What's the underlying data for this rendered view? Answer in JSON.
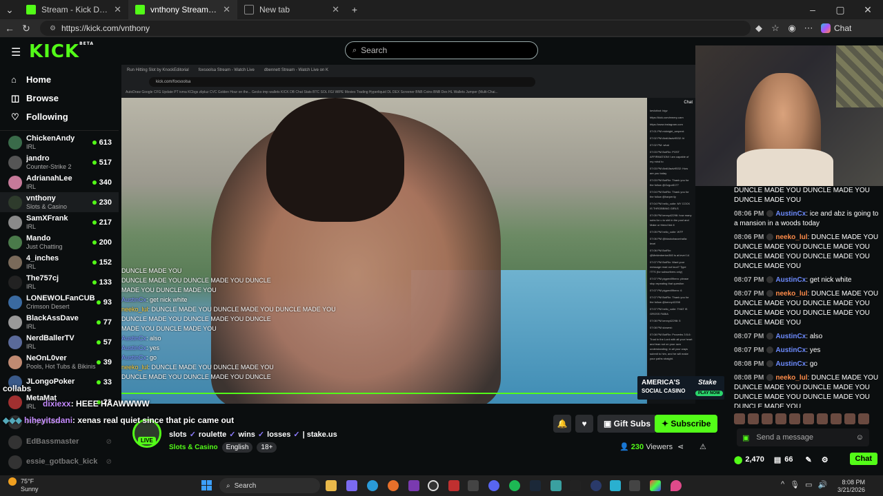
{
  "browser": {
    "tabs": [
      {
        "label": "Stream - Kick Dashboard",
        "active": false
      },
      {
        "label": "vnthony Stream - Watch Live on K",
        "active": true
      },
      {
        "label": "New tab",
        "active": false
      }
    ],
    "url": "https://kick.com/vnthony",
    "chat_label": "Chat"
  },
  "kick": {
    "logo": "KICK",
    "logo_tag": "BETA",
    "search_placeholder": "Search"
  },
  "sidebar": {
    "nav": [
      {
        "label": "Home",
        "icon": "home-icon"
      },
      {
        "label": "Browse",
        "icon": "browse-icon"
      },
      {
        "label": "Following",
        "icon": "heart-icon"
      }
    ],
    "channels": [
      {
        "name": "ChickenAndy",
        "category": "IRL",
        "viewers": "613",
        "color": "#3a6b4a"
      },
      {
        "name": "jandro",
        "category": "Counter-Strike 2",
        "viewers": "517",
        "color": "#555"
      },
      {
        "name": "AdrianahLee",
        "category": "IRL",
        "viewers": "340",
        "color": "#c67a9a"
      },
      {
        "name": "vnthony",
        "category": "Slots & Casino",
        "viewers": "230",
        "color": "#2e3b2c"
      },
      {
        "name": "SamXFrank",
        "category": "IRL",
        "viewers": "217",
        "color": "#8a8a8a"
      },
      {
        "name": "Mando",
        "category": "Just Chatting",
        "viewers": "200",
        "color": "#4a7a4a"
      },
      {
        "name": "4_inches",
        "category": "IRL",
        "viewers": "152",
        "color": "#7a6a5a"
      },
      {
        "name": "The757cj",
        "category": "IRL",
        "viewers": "133",
        "color": "#222"
      },
      {
        "name": "LONEWOLFanCUB",
        "category": "Crimson Desert",
        "viewers": "93",
        "color": "#3a6aa0"
      },
      {
        "name": "BlackAssDave",
        "category": "IRL",
        "viewers": "77",
        "color": "#999"
      },
      {
        "name": "NerdBallerTV",
        "category": "IRL",
        "viewers": "57",
        "color": "#5a6a9a"
      },
      {
        "name": "NeOnL0ver",
        "category": "Pools, Hot Tubs & Bikinis",
        "viewers": "39",
        "color": "#c08a72"
      },
      {
        "name": "JLongoPoker",
        "category": "",
        "viewers": "33",
        "color": "#3a5a8a"
      },
      {
        "name": "MetaMat",
        "category": "IRL",
        "viewers": "22",
        "color": "#a03030"
      }
    ],
    "offline": [
      {
        "name": "Heywhen"
      },
      {
        "name": "EdBassmaster"
      },
      {
        "name": "essie_gotback_kick"
      }
    ]
  },
  "inner_browser": {
    "tabs": [
      "Run Hitting Slot by KnockEditorial",
      "foxsoolsa Stream - Watch Live",
      "dbennett Stream - Watch Live on K"
    ],
    "url": "kick.com/foxsoolsa",
    "bookmarks": "AutoDraw  Google  CFG Update  PT  ivrna  KCbgs  zlipluz  CVC  Golden Hour on the...  Gecko  imp wallets  KICK  DB  Chat  Stats  BTC  SOL  FGI  WIPE  Movies  Trading  Hyperliquid  DL  DEX Screener  BNB Coins  BNB Dex  HL Wallets  Jumper (Multi-Chai...",
    "chat_title": "Chat",
    "chat_lines": [
      "kevlotbot: bigv",
      "https://kick.com/emery-cam",
      "https://www.instagram.com",
      "07:01 PM midnight_serpent:",
      "07:02 PM AbdUlaziz9532: hi",
      "07:02 PM: what",
      "07:03 PM BotRix: POST AFFIRMATION! I am capable of my mind to",
      "07:03 PM AbdUlaziz9532: How are you today",
      "07:03 PM BotRix: Thank you for the follow @Ozgur8177",
      "07:04 PM BotRix: Thank you for the follow @harper4y",
      "07:04 PM hello_cutie: MY COCK IS THROBBING GIRLS",
      "07:05 PM kenny42298: how many subs for u to shit in the pool and Make ur friend lick it",
      "07:05 PM hello_cutie: WTF",
      "07:06 PM @blackcbaconhalla: level",
      "07:06 PM BotRix: @Mekimberton360 is at level 14",
      "07:07 PM BotRix: Want your message read out loud? Type !TTS (for subscribers only)",
      "07:07 PM pigpevil9hero: please stop repeating that question",
      "07:07 PM pigpevil9hero: 6",
      "07:07 PM BotRix: Thank you for the follow @kenny42298",
      "07:07 PM hello_cutie: THAT IS GROSS FABIA",
      "07:08 PM kenny42298: 5",
      "07:08 PM slowest:",
      "07:08 PM BotRix: Proverbs 3:5-6: Trust in the Lord with all your heart and lean not on your own understanding; in all your ways submit to him, and he will make your paths straight."
    ]
  },
  "video_overlay": {
    "lines": [
      {
        "text": "DUNCLE MADE YOU",
        "user": "",
        "repeat": 3
      },
      {
        "text": "DUNCLE MADE YOU  DUNCLE MADE YOU  DUNCLE",
        "user": ""
      },
      {
        "text": "MADE YOU  DUNCLE MADE YOU",
        "user": ""
      },
      {
        "user": "AustinCx",
        "text": ": get nick white"
      },
      {
        "user": "neeko_lul",
        "text": ": DUNCLE MADE YOU  DUNCLE MADE YOU  DUNCLE MADE YOU"
      },
      {
        "text": "DUNCLE MADE YOU  DUNCLE MADE YOU  DUNCLE",
        "user": ""
      },
      {
        "text": "MADE YOU  DUNCLE MADE YOU",
        "user": ""
      },
      {
        "user": "AustinCx",
        "text": ": also"
      },
      {
        "user": "AustinCx",
        "text": ": yes"
      },
      {
        "user": "AustinCx",
        "text": ": go"
      },
      {
        "user": "neeko_lul",
        "text": ": DUNCLE MADE YOU  DUNCLE MADE YOU"
      },
      {
        "text": "DUNCLE MADE YOU  DUNCLE MADE YOU  DUNCLE",
        "user": ""
      }
    ],
    "ad": {
      "line1": "AMERICA'S",
      "line2": "SOCIAL CASINO",
      "brand": "Stake",
      "cta": "PLAY NOW"
    },
    "collabs": "collabs",
    "big_line1_user": "dixiexx",
    "big_line1_text": ": HEEE HAAWWWW",
    "big_line2_user": "hiheyitsdani",
    "big_line2_text": ": xenas real quiet since that pic came out"
  },
  "chat": {
    "messages": [
      {
        "time": "",
        "user": "",
        "user_color": "#fff",
        "text": "DUNCLE MADE YOU  DUNCLE MADE YOU  DUNCLE MADE YOU"
      },
      {
        "time": "08:06 PM",
        "user": "AustinCx",
        "user_color": "#6e8cff",
        "text": ": ice and abz is going to a mansion in a woods today"
      },
      {
        "time": "08:06 PM",
        "user": "neeko_lul",
        "user_color": "#ff8c4a",
        "text": ": DUNCLE MADE YOU  DUNCLE MADE YOU  DUNCLE MADE YOU  DUNCLE MADE YOU  DUNCLE MADE YOU  DUNCLE MADE YOU"
      },
      {
        "time": "08:07 PM",
        "user": "AustinCx",
        "user_color": "#6e8cff",
        "text": ": get nick white"
      },
      {
        "time": "08:07 PM",
        "user": "neeko_lul",
        "user_color": "#ff8c4a",
        "text": ": DUNCLE MADE YOU  DUNCLE MADE YOU  DUNCLE MADE YOU  DUNCLE MADE YOU  DUNCLE MADE YOU  DUNCLE MADE YOU"
      },
      {
        "time": "08:07 PM",
        "user": "AustinCx",
        "user_color": "#6e8cff",
        "text": ": also"
      },
      {
        "time": "08:07 PM",
        "user": "AustinCx",
        "user_color": "#6e8cff",
        "text": ": yes"
      },
      {
        "time": "08:08 PM",
        "user": "AustinCx",
        "user_color": "#6e8cff",
        "text": ": go"
      },
      {
        "time": "08:08 PM",
        "user": "neeko_lul",
        "user_color": "#ff8c4a",
        "text": ": DUNCLE MADE YOU  DUNCLE MADE YOU  DUNCLE MADE YOU  DUNCLE MADE YOU  DUNCLE MADE YOU  DUNCLE MADE YOU"
      }
    ],
    "input_placeholder": "Send a message",
    "points": "2,470",
    "other_count": "66",
    "chat_button": "Chat"
  },
  "stream": {
    "live_label": "LIVE",
    "title_tags": [
      "slots",
      "roulette",
      "wins",
      "losses",
      "| stake.us"
    ],
    "category": "Slots & Casino",
    "language": "English",
    "rating": "18+",
    "gift_subs": "Gift Subs",
    "subscribe": "Subscribe",
    "viewers_count": "230",
    "viewers_label": "Viewers",
    "accent": "#53fc18"
  },
  "taskbar": {
    "temp": "75°F",
    "weather": "Sunny",
    "search": "Search",
    "time": "8:08 PM",
    "date": "3/21/2026"
  }
}
